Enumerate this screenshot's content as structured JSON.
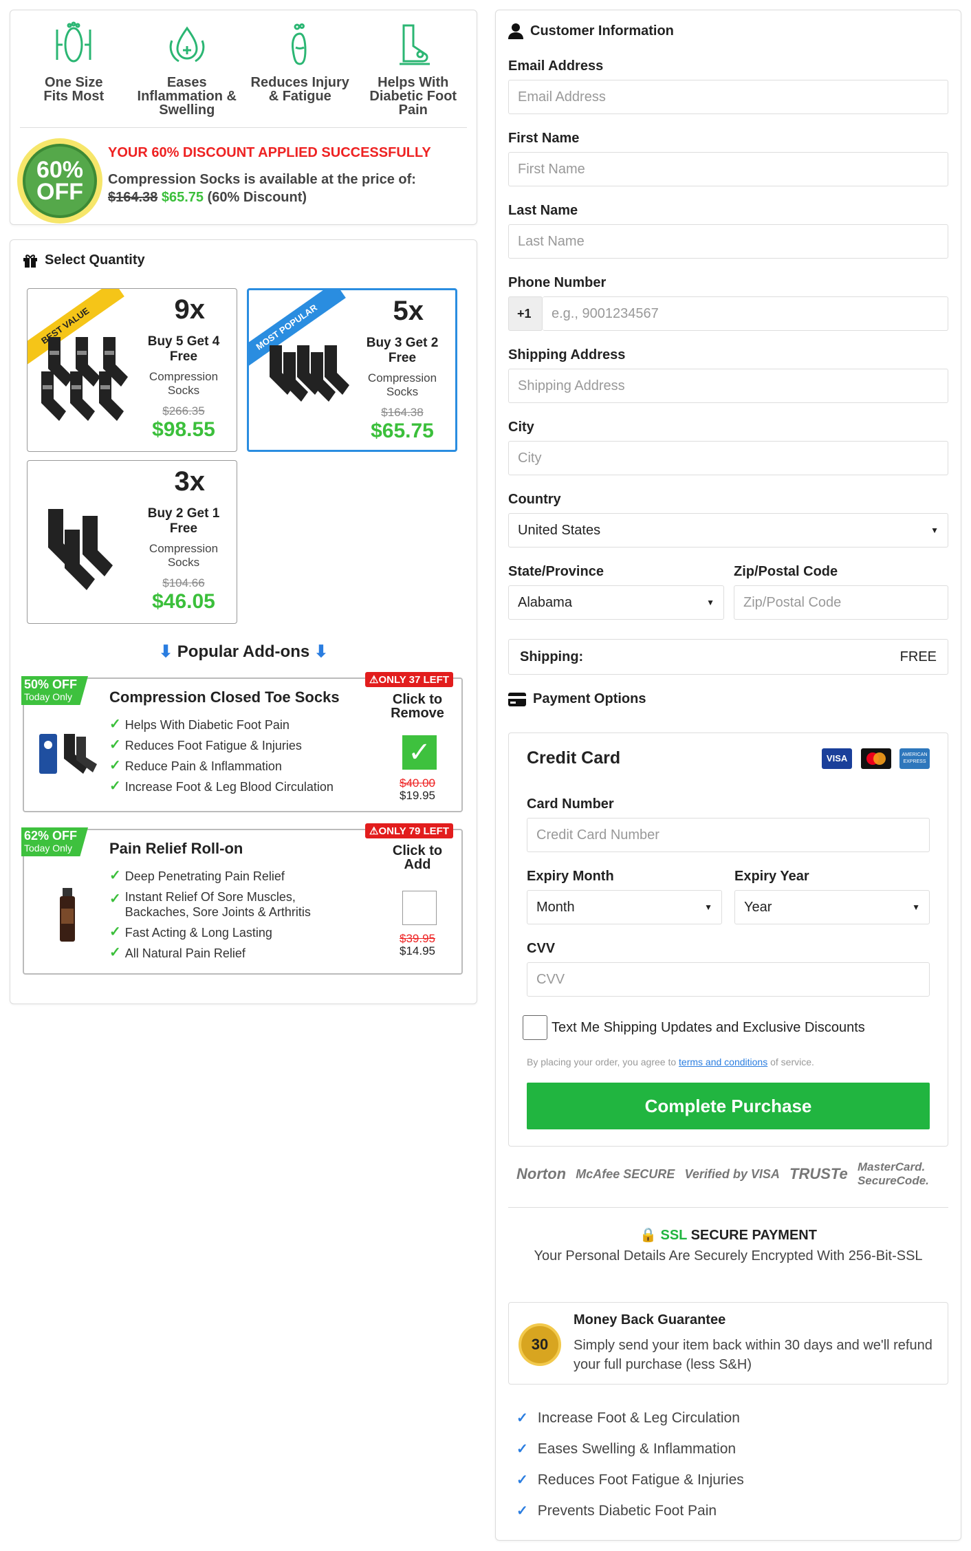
{
  "features": [
    {
      "label": "One Size\nFits Most",
      "icon": "foot-measure-icon"
    },
    {
      "label": "Eases\nInflammation &\nSwelling",
      "icon": "water-drop-icon"
    },
    {
      "label": "Reduces Injury\n& Fatigue",
      "icon": "footprint-icon"
    },
    {
      "label": "Helps With\nDiabetic Foot\nPain",
      "icon": "foot-pain-icon"
    }
  ],
  "discount": {
    "badge_top": "60%",
    "badge_bottom": "OFF",
    "headline": "YOUR 60% DISCOUNT APPLIED SUCCESSFULLY",
    "line": "Compression Socks is available at the price of:",
    "old_price": "$164.38",
    "new_price": "$65.75",
    "note": "(60% Discount)"
  },
  "quantity": {
    "heading": "Select Quantity",
    "options": [
      {
        "ribbon": "BEST VALUE",
        "count": "9x",
        "offer": "Buy 5 Get 4 Free",
        "sub": "Compression Socks",
        "old": "$266.35",
        "new": "$98.55",
        "selected": false
      },
      {
        "ribbon": "MOST POPULAR",
        "count": "5x",
        "offer": "Buy 3 Get 2 Free",
        "sub": "Compression Socks",
        "old": "$164.38",
        "new": "$65.75",
        "selected": true
      },
      {
        "ribbon": "",
        "count": "3x",
        "offer": "Buy 2 Get 1 Free",
        "sub": "Compression Socks",
        "old": "$104.66",
        "new": "$46.05",
        "selected": false
      }
    ]
  },
  "addons": {
    "heading": "Popular Add-ons",
    "items": [
      {
        "pct": "50% OFF",
        "today": "Today Only",
        "stock": "ONLY 37 LEFT",
        "title": "Compression Closed Toe Socks",
        "bullets": [
          "Helps With Diabetic Foot Pain",
          "Reduces Foot Fatigue & Injuries",
          "Reduce Pain & Inflammation",
          "Increase Foot & Leg Blood Circulation"
        ],
        "cta": "Click to Remove",
        "old": "$40.00",
        "new": "$19.95",
        "checked": true
      },
      {
        "pct": "62% OFF",
        "today": "Today Only",
        "stock": "ONLY 79 LEFT",
        "title": "Pain Relief Roll-on",
        "bullets": [
          "Deep Penetrating Pain Relief",
          "Instant Relief Of Sore Muscles, Backaches, Sore Joints & Arthritis",
          "Fast Acting & Long Lasting",
          "All Natural Pain Relief"
        ],
        "cta": "Click to Add",
        "old": "$39.95",
        "new": "$14.95",
        "checked": false
      }
    ]
  },
  "customer": {
    "heading": "Customer Information",
    "email_label": "Email Address",
    "email_ph": "Email Address",
    "first_label": "First Name",
    "first_ph": "First Name",
    "last_label": "Last Name",
    "last_ph": "Last Name",
    "phone_label": "Phone Number",
    "phone_code": "+1",
    "phone_ph": "e.g., 9001234567",
    "ship_label": "Shipping Address",
    "ship_ph": "Shipping Address",
    "city_label": "City",
    "city_ph": "City",
    "country_label": "Country",
    "country_value": "United States",
    "state_label": "State/Province",
    "state_value": "Alabama",
    "zip_label": "Zip/Postal Code",
    "zip_ph": "Zip/Postal Code",
    "shipping_label": "Shipping:",
    "shipping_value": "FREE"
  },
  "payment": {
    "heading": "Payment Options",
    "card_title": "Credit Card",
    "card_logos": [
      "VISA",
      "MASTERCARD",
      "AMERICAN EXPRESS"
    ],
    "number_label": "Card Number",
    "number_ph": "Credit Card Number",
    "month_label": "Expiry Month",
    "month_value": "Month",
    "year_label": "Expiry Year",
    "year_value": "Year",
    "cvv_label": "CVV",
    "cvv_ph": "CVV",
    "sms_label": "Text Me Shipping Updates and Exclusive Discounts",
    "terms_pre": "By placing your order, you agree to",
    "terms_link": "terms and conditions",
    "terms_post": "of service.",
    "button": "Complete Purchase"
  },
  "trust_badges": [
    "Norton",
    "McAfee SECURE",
    "Verified by VISA",
    "TRUSTe",
    "MasterCard. SecureCode."
  ],
  "ssl": {
    "label": "SSL",
    "title": "SECURE PAYMENT",
    "text": "Your Personal Details Are Securely Encrypted With 256-Bit-SSL"
  },
  "guarantee": {
    "title": "Money Back Guarantee",
    "text": "Simply send your item back within 30 days and we'll refund your full purchase (less S&H)",
    "seal": "30"
  },
  "benefits": [
    "Increase Foot & Leg Circulation",
    "Eases Swelling & Inflammation",
    "Reduces Foot Fatigue & Injuries",
    "Prevents Diabetic Foot Pain"
  ],
  "colors": {
    "accent_green": "#21b540",
    "price_green": "#3bbf3b",
    "alert_red": "#e22222",
    "select_blue": "#2a8de0"
  }
}
